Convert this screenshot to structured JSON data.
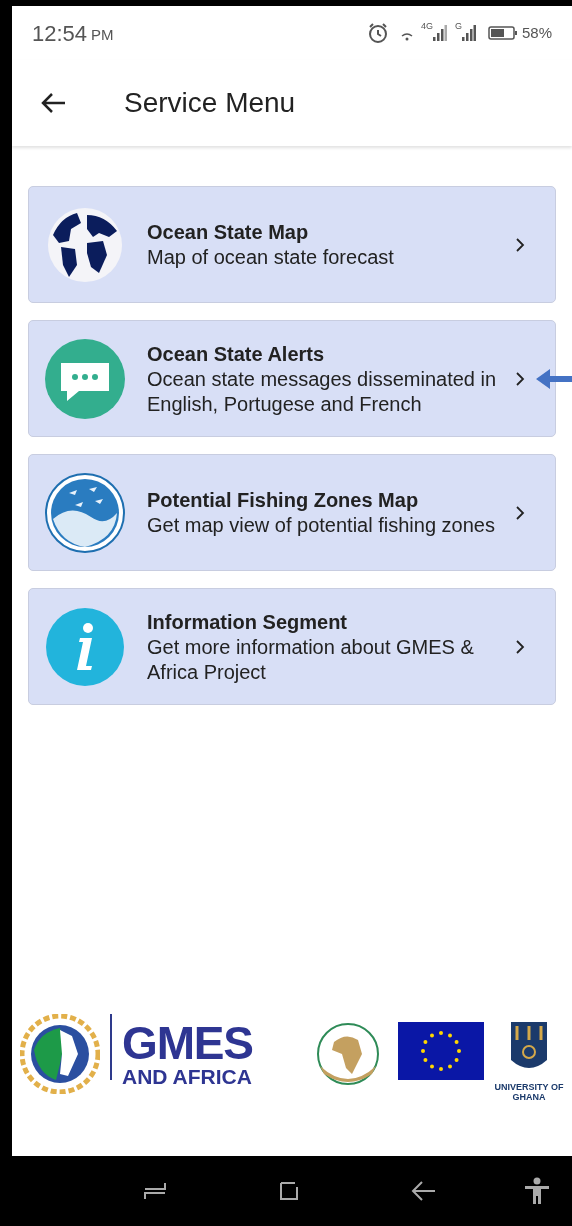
{
  "status_bar": {
    "time": "12:54",
    "ampm": "PM",
    "network_1": "4G",
    "network_2": "G",
    "battery": "58%"
  },
  "app_bar": {
    "title": "Service Menu"
  },
  "items": [
    {
      "kind": "globe",
      "title": "Ocean State Map",
      "subtitle": "Map of ocean state forecast",
      "pointed": false
    },
    {
      "kind": "chat",
      "title": "Ocean State Alerts",
      "subtitle": "Ocean state messages disseminated in English, Portugese and French",
      "pointed": true
    },
    {
      "kind": "fish",
      "title": "Potential Fishing Zones Map",
      "subtitle": "Get map view of potential fishing zones",
      "pointed": false
    },
    {
      "kind": "info",
      "title": "Information Segment",
      "subtitle": "Get more information about GMES & Africa Project",
      "pointed": false
    }
  ],
  "footer": {
    "brand_main": "GMES",
    "brand_sub": "AND AFRICA",
    "university": "UNIVERSITY OF GHANA"
  }
}
